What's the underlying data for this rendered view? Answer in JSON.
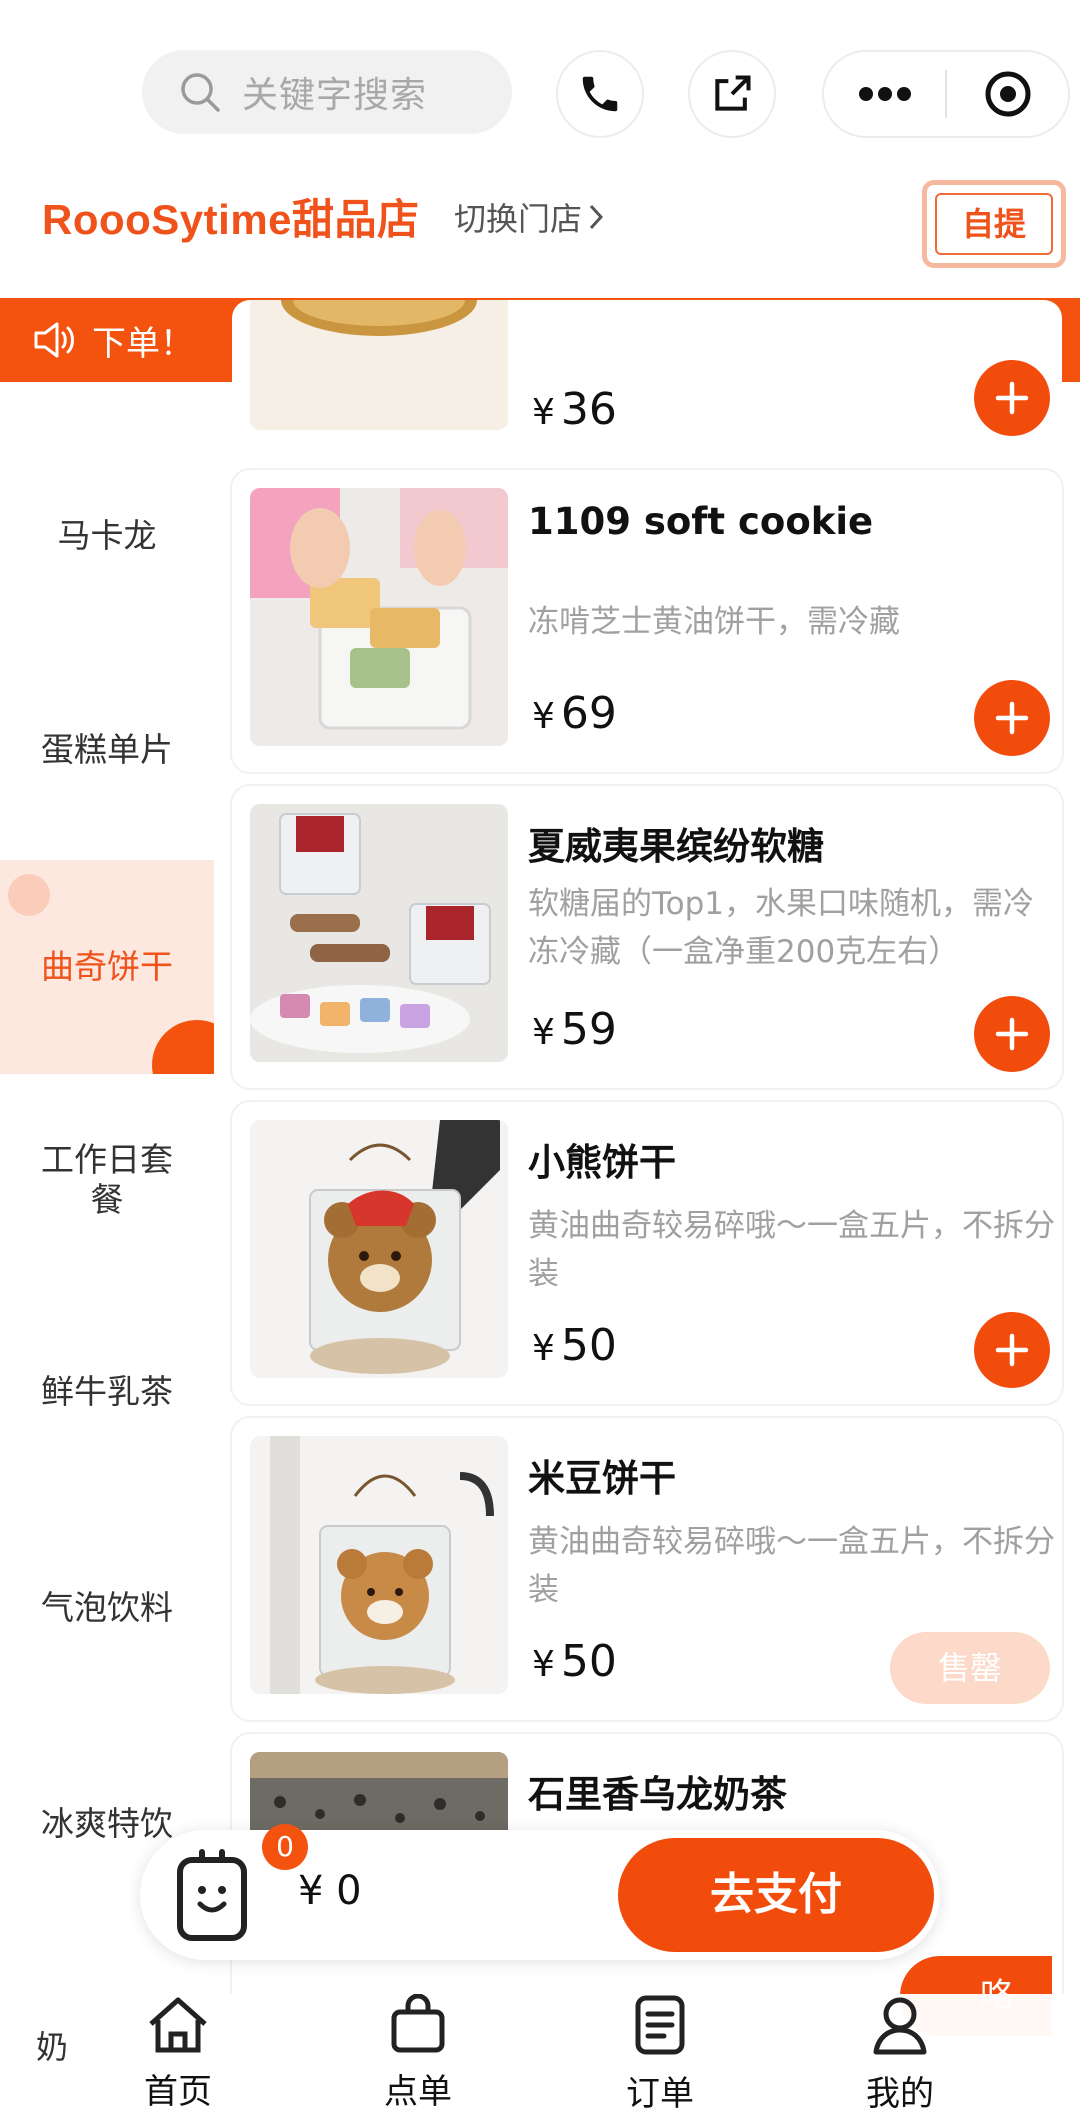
{
  "search": {
    "placeholder": "关键字搜索"
  },
  "shop": {
    "name": "RoooSytime甜品店",
    "switch_label": "切换门店",
    "pickup_label": "自提"
  },
  "notice": {
    "text": "下单！"
  },
  "categories": [
    {
      "label": "马卡龙"
    },
    {
      "label": "蛋糕单片"
    },
    {
      "label": "曲奇饼干",
      "active": true
    },
    {
      "label": "工作日套餐"
    },
    {
      "label": "鲜牛乳茶"
    },
    {
      "label": "气泡饮料"
    },
    {
      "label": "冰爽特饮"
    },
    {
      "label": "奶"
    }
  ],
  "products": [
    {
      "name": "",
      "desc": "",
      "price": "36",
      "currency": "¥"
    },
    {
      "name": "1109 soft cookie",
      "desc": "冻啃芝士黄油饼干，需冷藏",
      "price": "69",
      "currency": "¥"
    },
    {
      "name": "夏威夷果缤纷软糖",
      "desc": "软糖届的Top1，水果口味随机，需冷冻冷藏（一盒净重200克左右）",
      "price": "59",
      "currency": "¥"
    },
    {
      "name": "小熊饼干",
      "desc": "黄油曲奇较易碎哦～一盒五片，不拆分装",
      "price": "50",
      "currency": "¥"
    },
    {
      "name": "米豆饼干",
      "desc": "黄油曲奇较易碎哦～一盒五片，不拆分装",
      "price": "50",
      "currency": "¥",
      "sold_out_label": "售罄"
    },
    {
      "name": "石里香乌龙奶茶",
      "desc": "",
      "price": "",
      "currency": ""
    }
  ],
  "cart": {
    "count": "0",
    "total": "¥ 0",
    "pay_label": "去支付",
    "float_label": "咯"
  },
  "tabs": [
    {
      "label": "首页",
      "icon": "home-icon"
    },
    {
      "label": "点单",
      "icon": "bag-icon"
    },
    {
      "label": "订单",
      "icon": "order-list-icon"
    },
    {
      "label": "我的",
      "icon": "user-icon"
    }
  ],
  "colors": {
    "accent": "#f24c0d",
    "accent_light": "#fde8df",
    "brand_text": "#f0521b"
  }
}
